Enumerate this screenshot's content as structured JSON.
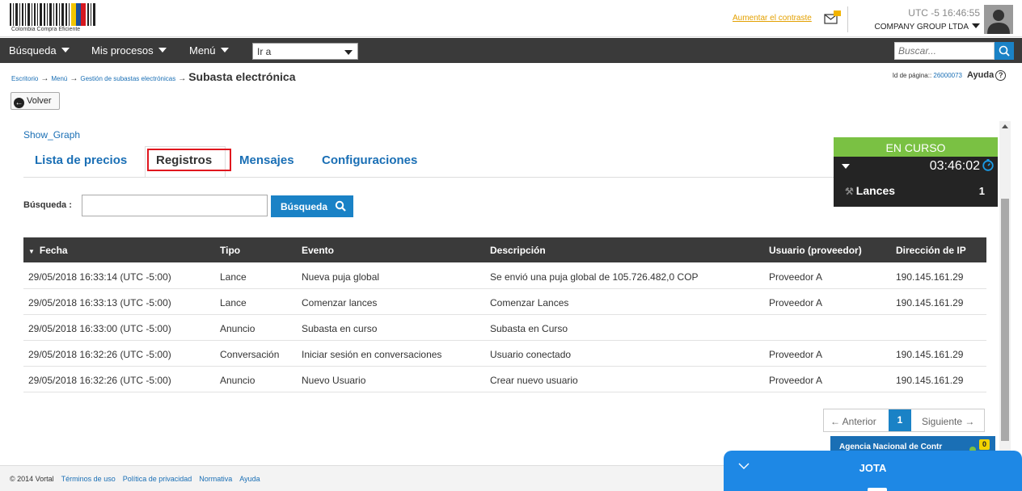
{
  "header": {
    "logo_text": "Colombia Compra Eficiente",
    "contrast_link": "Aumentar el contraste",
    "clock": "UTC -5 16:46:55",
    "company": "COMPANY GROUP LTDA"
  },
  "nav": {
    "busqueda": "Búsqueda",
    "mis_procesos": "Mis procesos",
    "menu": "Menú",
    "goto": "Ir a",
    "search_placeholder": "Buscar..."
  },
  "breadcrumb": {
    "escritorio": "Escritorio",
    "menu": "Menú",
    "gestion": "Gestión de subastas electrónicas",
    "current": "Subasta electrónica",
    "arrow": "→"
  },
  "page_id": {
    "label": "Id de página:: ",
    "value": "26000073",
    "help": "Ayuda"
  },
  "back_button": "Volver",
  "show_graph": "Show_Graph",
  "tabs": [
    {
      "label": "Lista de precios"
    },
    {
      "label": "Registros"
    },
    {
      "label": "Mensajes"
    },
    {
      "label": "Configuraciones"
    }
  ],
  "search": {
    "label": "Búsqueda :",
    "button": "Búsqueda"
  },
  "table": {
    "headers": [
      "Fecha",
      "Tipo",
      "Evento",
      "Descripción",
      "Usuario (proveedor)",
      "Dirección de IP"
    ],
    "rows": [
      [
        "29/05/2018 16:33:14 (UTC -5:00)",
        "Lance",
        "Nueva puja global",
        "Se envió una puja global de 105.726.482,0 COP",
        "Proveedor A",
        "190.145.161.29"
      ],
      [
        "29/05/2018 16:33:13 (UTC -5:00)",
        "Lance",
        "Comenzar lances",
        "Comenzar Lances",
        "Proveedor A",
        "190.145.161.29"
      ],
      [
        "29/05/2018 16:33:00 (UTC -5:00)",
        "Anuncio",
        "Subasta en curso",
        "Subasta en Curso",
        "",
        ""
      ],
      [
        "29/05/2018 16:32:26 (UTC -5:00)",
        "Conversación",
        "Iniciar sesión en conversaciones",
        "Usuario conectado",
        "Proveedor A",
        "190.145.161.29"
      ],
      [
        "29/05/2018 16:32:26 (UTC -5:00)",
        "Anuncio",
        "Nuevo Usuario",
        "Crear nuevo usuario",
        "Proveedor A",
        "190.145.161.29"
      ]
    ]
  },
  "pager": {
    "prev": "← Anterior",
    "current": "1",
    "next": "Siguiente →"
  },
  "status": {
    "state": "EN CURSO",
    "timer": "03:46:02",
    "lances_label": "Lances",
    "lances_count": "1",
    "state_color": "#7ac143"
  },
  "agency": {
    "name": "Agencia Nacional de Contr",
    "badge": "0"
  },
  "footer": {
    "copyright": "© 2014 Vortal",
    "links": [
      "Términos de uso",
      "Política de privacidad",
      "Normativa",
      "Ayuda"
    ]
  },
  "chat": {
    "title": "JOTA"
  },
  "colors": {
    "accent": "#1a82c6",
    "nav_bg": "#3a3a3a",
    "highlight": "#e0161e"
  }
}
